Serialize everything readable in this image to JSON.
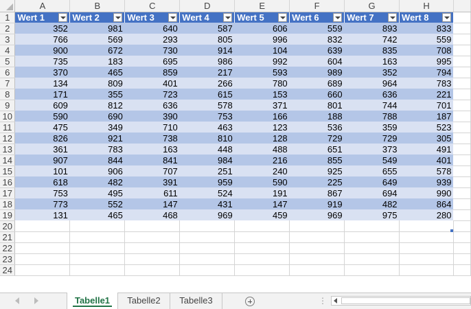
{
  "column_letters": [
    "A",
    "B",
    "C",
    "D",
    "E",
    "F",
    "G",
    "H"
  ],
  "row_numbers": [
    "1",
    "2",
    "3",
    "4",
    "5",
    "6",
    "7",
    "8",
    "9",
    "10",
    "11",
    "12",
    "13",
    "14",
    "15",
    "16",
    "17",
    "18",
    "19",
    "20",
    "21",
    "22",
    "23",
    "24"
  ],
  "table": {
    "headers": [
      "Wert 1",
      "Wert 2",
      "Wert 3",
      "Wert 4",
      "Wert 5",
      "Wert 6",
      "Wert 7",
      "Wert 8"
    ],
    "rows": [
      [
        "352",
        "981",
        "640",
        "587",
        "606",
        "559",
        "893",
        "833"
      ],
      [
        "766",
        "569",
        "293",
        "805",
        "996",
        "832",
        "742",
        "559"
      ],
      [
        "900",
        "672",
        "730",
        "914",
        "104",
        "639",
        "835",
        "708"
      ],
      [
        "735",
        "183",
        "695",
        "986",
        "992",
        "604",
        "163",
        "995"
      ],
      [
        "370",
        "465",
        "859",
        "217",
        "593",
        "989",
        "352",
        "794"
      ],
      [
        "134",
        "809",
        "401",
        "266",
        "780",
        "689",
        "964",
        "783"
      ],
      [
        "171",
        "355",
        "723",
        "615",
        "153",
        "660",
        "636",
        "221"
      ],
      [
        "609",
        "812",
        "636",
        "578",
        "371",
        "801",
        "744",
        "701"
      ],
      [
        "590",
        "690",
        "390",
        "753",
        "166",
        "188",
        "788",
        "187"
      ],
      [
        "475",
        "349",
        "710",
        "463",
        "123",
        "536",
        "359",
        "523"
      ],
      [
        "826",
        "921",
        "738",
        "810",
        "128",
        "729",
        "729",
        "305"
      ],
      [
        "361",
        "783",
        "163",
        "448",
        "488",
        "651",
        "373",
        "491"
      ],
      [
        "907",
        "844",
        "841",
        "984",
        "216",
        "855",
        "549",
        "401"
      ],
      [
        "101",
        "906",
        "707",
        "251",
        "240",
        "925",
        "655",
        "578"
      ],
      [
        "618",
        "482",
        "391",
        "959",
        "590",
        "225",
        "649",
        "939"
      ],
      [
        "753",
        "495",
        "611",
        "524",
        "191",
        "867",
        "694",
        "990"
      ],
      [
        "773",
        "552",
        "147",
        "431",
        "147",
        "919",
        "482",
        "864"
      ],
      [
        "131",
        "465",
        "468",
        "969",
        "459",
        "969",
        "975",
        "280"
      ]
    ],
    "band_colors": [
      "#b4c6e7",
      "#d9e1f2"
    ],
    "header_color": "#4472c4"
  },
  "sheet_tabs": [
    "Tabelle1",
    "Tabelle2",
    "Tabelle3"
  ],
  "active_tab": "Tabelle1",
  "icons": {
    "add_sheet": "plus-circle-icon",
    "filter": "dropdown-arrow-icon",
    "nav_left": "triangle-left-icon",
    "nav_right": "triangle-right-icon"
  },
  "colors": {
    "accent": "#217346"
  }
}
